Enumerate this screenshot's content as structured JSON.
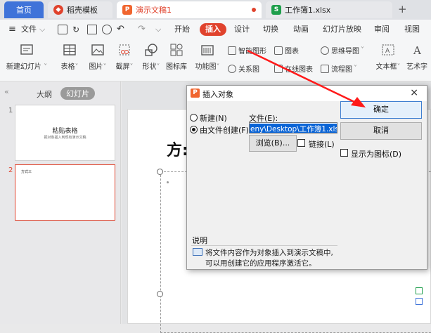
{
  "tabs": [
    {
      "label": "首页"
    },
    {
      "label": "稻壳模板"
    },
    {
      "label": "演示文稿1"
    },
    {
      "label": "工作簿1.xlsx"
    }
  ],
  "menubar": {
    "file_label": "文件",
    "items": [
      "开始",
      "插入",
      "设计",
      "切换",
      "动画",
      "幻灯片放映",
      "审阅",
      "视图"
    ],
    "active": "插入"
  },
  "ribbon": {
    "new_slide": "新建幻灯片",
    "table": "表格",
    "picture": "图片",
    "screenshot": "截屏",
    "shape": "形状",
    "icon_library": "图标库",
    "function_chart": "功能图",
    "smart_graphic": "智能图形",
    "chart": "图表",
    "mind_map": "思维导图",
    "relation_chart": "关系图",
    "online_chart": "在线图表",
    "flowchart": "流程图",
    "textbox": "文本框",
    "art_text": "艺术字"
  },
  "leftpanel": {
    "tab_outline": "大纲",
    "tab_slides": "幻灯片",
    "slide1": {
      "number": "1",
      "title": "粘贴表格",
      "subtitle": "把对象插入到现有演示文稿"
    },
    "slide2": {
      "number": "2",
      "title": "方式三"
    }
  },
  "slide": {
    "title_partial": "方:"
  },
  "dialog": {
    "title": "插入对象",
    "close": "×",
    "radio_new": "新建(N)",
    "radio_from_file": "由文件创建(F)",
    "file_label": "文件(E):",
    "file_value": "eny\\Desktop\\工作簿1.xlsx",
    "browse_button": "浏览(B)...",
    "link_label": "链接(L)",
    "ok_button": "确定",
    "cancel_button": "取消",
    "show_as_icon": "显示为图标(D)",
    "desc_heading": "说明",
    "desc_line1": "将文件内容作为对象插入到演示文稿中,",
    "desc_line2": "可以用创建它的应用程序激活它。"
  },
  "colors": {
    "accent_red": "#e0432d",
    "wps_orange": "#f0652f",
    "xlsx_green": "#1e9e4b",
    "selection_blue": "#0a64d6",
    "arrow_red": "#ff1a1a"
  }
}
